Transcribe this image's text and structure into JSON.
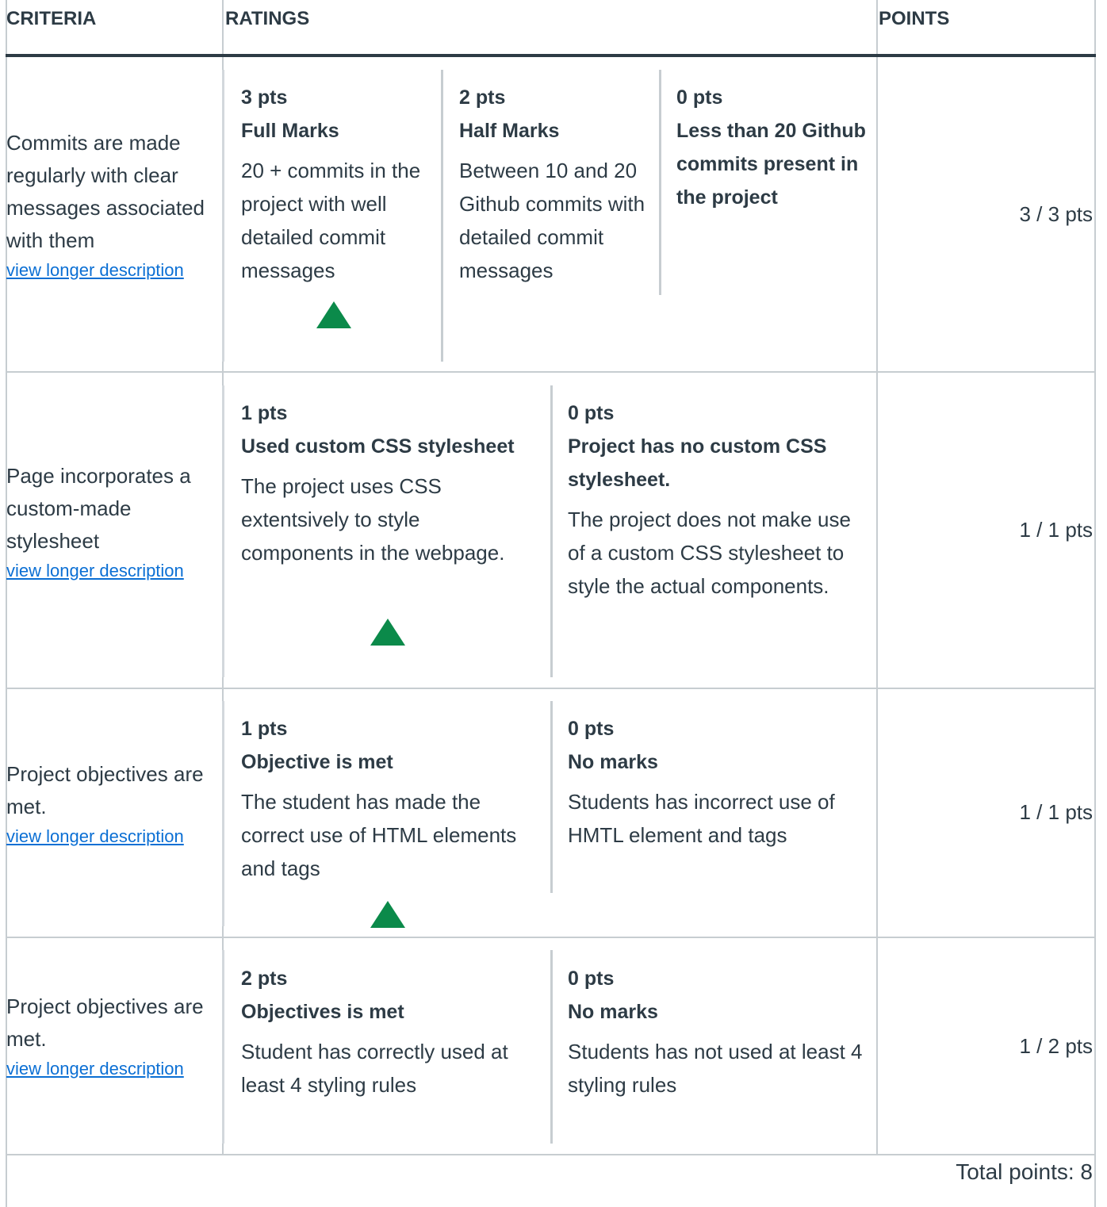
{
  "header": {
    "criteria": "CRITERIA",
    "ratings": "RATINGS",
    "points": "POINTS"
  },
  "rows": [
    {
      "criterion": "Commits are made regularly with clear messages associated with them",
      "link": "view longer description",
      "ratings": [
        {
          "pts": "3 pts",
          "title": "Full Marks",
          "desc": "20 + commits in the project with well detailed commit messages",
          "selected": true
        },
        {
          "pts": "2 pts",
          "title": "Half Marks",
          "desc": "Between 10 and 20 Github commits with detailed commit messages",
          "selected": false
        },
        {
          "pts": "0 pts",
          "title": "Less than 20 Github commits present in the project",
          "desc": "",
          "selected": false
        }
      ],
      "score": "3 / 3 pts"
    },
    {
      "criterion": "Page incorporates a custom-made stylesheet",
      "link": "view longer description",
      "ratings": [
        {
          "pts": "1 pts",
          "title": "Used custom CSS stylesheet",
          "desc": "The project uses CSS extentsively to style components in the webpage.",
          "selected": true
        },
        {
          "pts": "0 pts",
          "title": "Project has no custom CSS stylesheet.",
          "desc": "The project does not make use of a custom CSS stylesheet to style the actual components.",
          "selected": false
        }
      ],
      "score": "1 / 1 pts"
    },
    {
      "criterion": "Project objectives are met.",
      "link": "view longer description",
      "ratings": [
        {
          "pts": "1 pts",
          "title": "Objective is met",
          "desc": "The student has made the correct use of HTML elements and tags",
          "selected": true
        },
        {
          "pts": "0 pts",
          "title": "No marks",
          "desc": "Students has incorrect use of HMTL element and tags",
          "selected": false
        }
      ],
      "score": "1 / 1 pts"
    },
    {
      "criterion": "Project objectives are met.",
      "link": "view longer description",
      "ratings": [
        {
          "pts": "2 pts",
          "title": "Objectives is met",
          "desc": "Student has correctly used at least 4 styling rules",
          "selected": false
        },
        {
          "pts": "0 pts",
          "title": "No marks",
          "desc": "Students has not used at least 4 styling rules",
          "selected": false
        }
      ],
      "score": "1 / 2 pts"
    }
  ],
  "total": "Total points: 8",
  "colors": {
    "selected_marker": "#0b8a4a",
    "link": "#0b6fd4",
    "border": "#c7cdd1",
    "text": "#2d3b45"
  }
}
